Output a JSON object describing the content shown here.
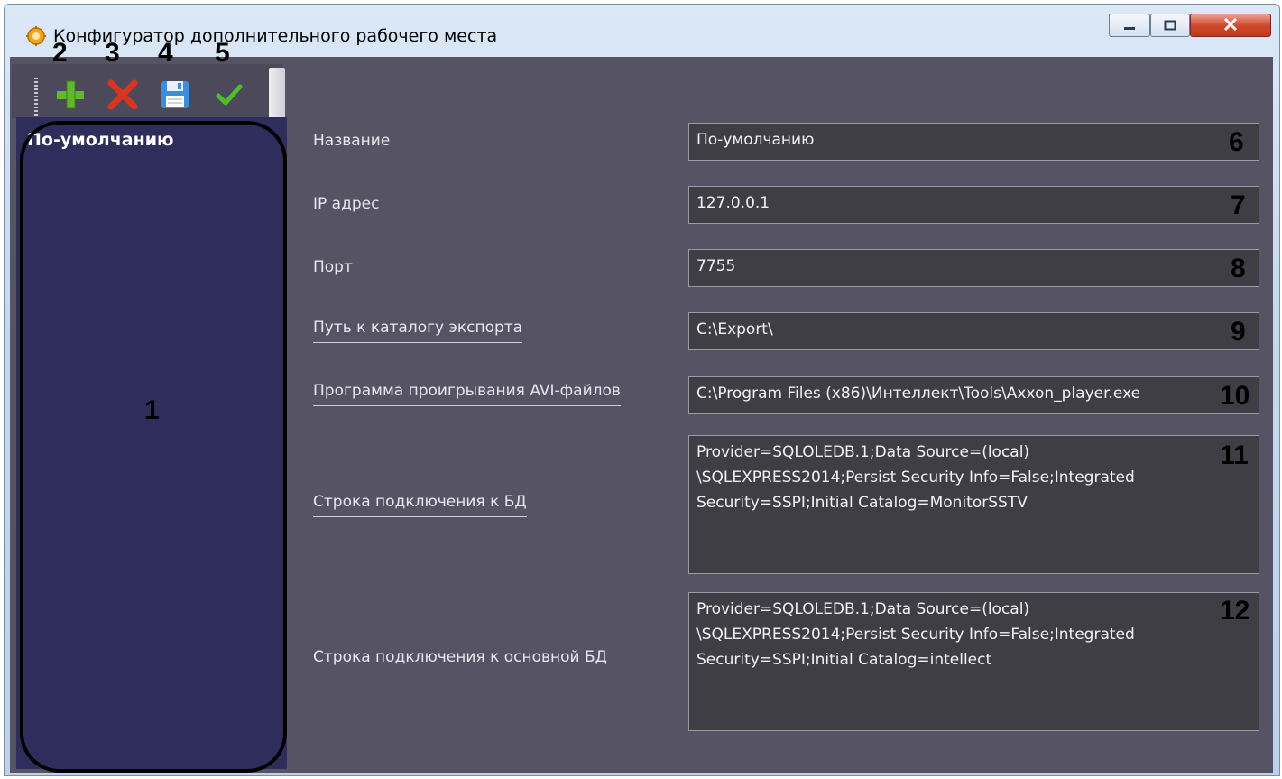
{
  "window": {
    "title": "Конфигуратор дополнительного рабочего места",
    "controls": {
      "minimize": "—",
      "maximize": "□",
      "close": "X"
    }
  },
  "toolbar": {
    "buttons": [
      {
        "name": "add",
        "icon": "plus-icon",
        "color": "#5cb82a"
      },
      {
        "name": "delete",
        "icon": "x-icon",
        "color": "#d93a26"
      },
      {
        "name": "save",
        "icon": "floppy-disk-icon",
        "color": "#3b8ede"
      },
      {
        "name": "apply",
        "icon": "checkmark-icon",
        "color": "#4dbf2a"
      }
    ]
  },
  "callouts": [
    "1",
    "2",
    "3",
    "4",
    "5",
    "6",
    "7",
    "8",
    "9",
    "10",
    "11",
    "12"
  ],
  "list": {
    "items": [
      "По-умолчанию"
    ]
  },
  "form": {
    "fields": [
      {
        "label": "Название",
        "value": "По-умолчанию"
      },
      {
        "label": "IP адрес",
        "value": "127.0.0.1"
      },
      {
        "label": "Порт",
        "value": "7755"
      },
      {
        "label": "Путь к каталогу экспорта",
        "value": "C:\\Export\\"
      },
      {
        "label": "Программа проигрывания AVI-файлов",
        "value": "C:\\Program Files (x86)\\Интеллект\\Tools\\Axxon_player.exe"
      },
      {
        "label": "Строка подключения к БД",
        "value": "Provider=SQLOLEDB.1;Data Source=(local)\n\\SQLEXPRESS2014;Persist Security Info=False;Integrated\nSecurity=SSPI;Initial Catalog=MonitorSSTV"
      },
      {
        "label": "Строка подключения к основной БД",
        "value": "Provider=SQLOLEDB.1;Data Source=(local)\n\\SQLEXPRESS2014;Persist Security Info=False;Integrated\nSecurity=SSPI;Initial Catalog=intellect"
      }
    ]
  },
  "colors": {
    "client_bg": "#565464",
    "list_bg": "#2e2d5b",
    "field_bg": "#3f3e45"
  }
}
